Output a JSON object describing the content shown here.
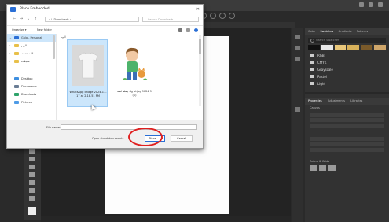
{
  "dialog": {
    "title": "Place Embedded",
    "close_glyph": "✕",
    "address": "›  ↓  Downloads  ›",
    "search_placeholder": "Search Downloads",
    "organize_label": "Organize ▾",
    "new_folder_label": "New folder",
    "pane_label": "اليوم",
    "nav_items": [
      {
        "label": "Gala - Personal",
        "selected": true
      },
      {
        "label": "اليوم"
      },
      {
        "label": "المستندات"
      },
      {
        "label": "سجلات"
      },
      {
        "label": "Desktop"
      },
      {
        "label": "Documents"
      },
      {
        "label": "Downloads"
      },
      {
        "label": "Pictures"
      }
    ],
    "files": [
      {
        "name": "WhatsApp Image 2024-11-17 at 2.18.51 PM",
        "selected": true
      },
      {
        "name": "ولد يتعلم لعبة ai.jpg 9024 9 (1)",
        "selected": false
      }
    ],
    "file_name_label": "File name:",
    "file_name_value": "",
    "cloud_button": "Open cloud documents",
    "place_button": "Place",
    "cancel_button": "Cancel"
  },
  "photoshop": {
    "panel_tabs": [
      "Color",
      "Swatches",
      "Gradients",
      "Patterns"
    ],
    "swatch_search_placeholder": "Search Swatches",
    "swatch_groups": [
      "RGB",
      "CMYK",
      "Grayscale",
      "Pastel",
      "Light"
    ],
    "props_tabs": [
      "Properties",
      "Adjustments",
      "Libraries"
    ],
    "props_section": "Canvas",
    "rulers_label": "Rulers & Grids"
  },
  "colors": {
    "accent": "#2a6fd6",
    "highlight_circle": "#e02020",
    "selection": "#cde6fb"
  }
}
